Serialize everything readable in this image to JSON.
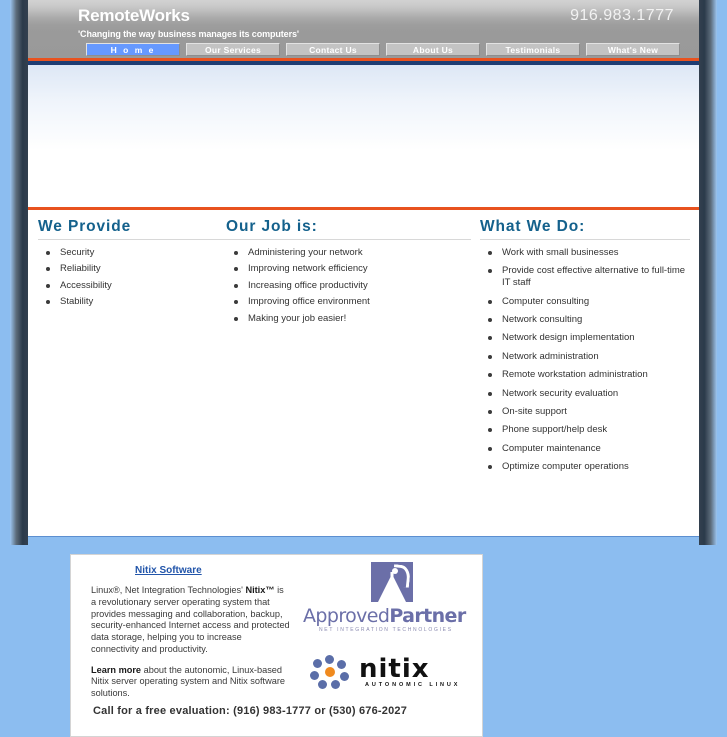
{
  "header": {
    "brand": "RemoteWorks",
    "phone": "916.983.1777",
    "tagline": "'Changing the way business manages its computers'",
    "nav": [
      {
        "label": "H o m e",
        "active": true
      },
      {
        "label": "Our Services",
        "active": false
      },
      {
        "label": "Contact Us",
        "active": false
      },
      {
        "label": "About Us",
        "active": false
      },
      {
        "label": "Testimonials",
        "active": false
      },
      {
        "label": "What's New",
        "active": false
      }
    ]
  },
  "colors": {
    "accent_orange": "#e8521f",
    "accent_navy": "#1f3d73",
    "heading_teal": "#14618c",
    "nav_active_blue": "#6699ff",
    "page_blue": "#8cbdf0",
    "partner_purple": "#6b6fa8",
    "nitix_orange": "#f08a1e"
  },
  "columns": [
    {
      "title": "We Provide",
      "items": [
        "Security",
        "Reliability",
        "Accessibility",
        "Stability"
      ]
    },
    {
      "title": "Our Job is:",
      "items": [
        "Administering your network",
        "Improving network efficiency",
        "Increasing office productivity",
        "Improving office environment",
        "Making your job easier!"
      ]
    },
    {
      "title": "What We Do:",
      "items": [
        "Work with small businesses",
        "Provide cost effective alternative to full-time IT staff",
        "Computer consulting",
        "Network consulting",
        "Network design implementation",
        "Network administration",
        "Remote workstation administration",
        "Network security evaluation",
        "On-site support",
        "Phone support/help desk",
        "Computer maintenance",
        "Optimize computer operations"
      ]
    }
  ],
  "promo": {
    "link": "Nitix Software",
    "paragraph1_pre": "Linux®, Net Integration Technologies' ",
    "paragraph1_bold": "Nitix™",
    "paragraph1_post": " is a revolutionary server operating system that provides messaging and collaboration, backup, security-enhanced Internet access and protected data storage, helping you to increase connectivity and productivity.",
    "paragraph2_bold": "Learn more",
    "paragraph2_post": " about the autonomic, Linux-based Nitix server operating system and Nitix software solutions.",
    "partner_word_light": "Approved",
    "partner_word_bold": "Partner",
    "partner_sub": "NET INTEGRATION TECHNOLOGIES",
    "nitix_word": "nitix",
    "nitix_sub": "AUTONOMIC LINUX",
    "cta": "Call for a free evaluation: (916) 983-1777 or (530) 676-2027"
  }
}
